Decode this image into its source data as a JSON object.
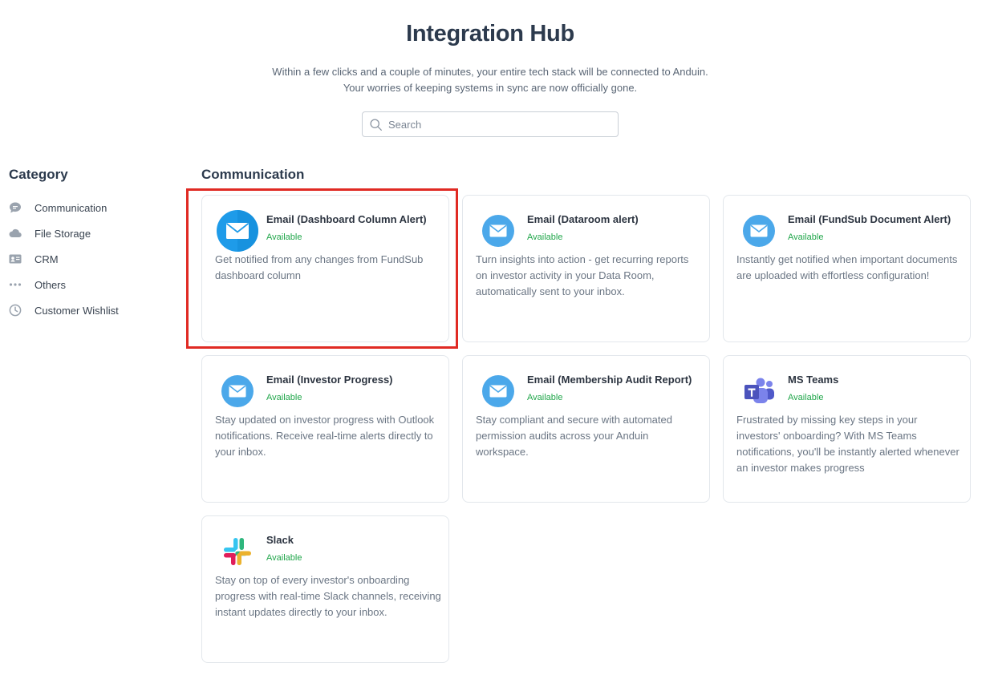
{
  "header": {
    "title": "Integration Hub",
    "subtitle_line1": "Within a few clicks and a couple of minutes, your entire tech stack will be connected to Anduin.",
    "subtitle_line2": "Your worries of keeping systems in sync are now officially gone."
  },
  "search": {
    "placeholder": "Search",
    "value": ""
  },
  "sidebar": {
    "title": "Category",
    "items": [
      {
        "label": "Communication",
        "icon": "chat-bubble-icon"
      },
      {
        "label": "File Storage",
        "icon": "cloud-icon"
      },
      {
        "label": "CRM",
        "icon": "contact-card-icon"
      },
      {
        "label": "Others",
        "icon": "ellipsis-icon"
      },
      {
        "label": "Customer Wishlist",
        "icon": "clock-icon"
      }
    ]
  },
  "main": {
    "section_title": "Communication",
    "cards": [
      {
        "title": "Email (Dashboard Column Alert)",
        "status": "Available",
        "description": "Get notified from any changes from FundSub dashboard column",
        "icon": "email-icon"
      },
      {
        "title": "Email (Dataroom alert)",
        "status": "Available",
        "description": "Turn insights into action - get recurring reports on investor activity in your Data Room, automatically sent to your inbox.",
        "icon": "email-icon"
      },
      {
        "title": "Email (FundSub Document Alert)",
        "status": "Available",
        "description": "Instantly get notified when important documents are uploaded with effortless configuration!",
        "icon": "email-icon"
      },
      {
        "title": "Email (Investor Progress)",
        "status": "Available",
        "description": "Stay updated on investor progress with Outlook notifications. Receive real-time alerts directly to your inbox.",
        "icon": "email-icon"
      },
      {
        "title": "Email (Membership Audit Report)",
        "status": "Available",
        "description": "Stay compliant and secure with automated permission audits across your Anduin workspace.",
        "icon": "email-icon"
      },
      {
        "title": "MS Teams",
        "status": "Available",
        "description": "Frustrated by missing key steps in your investors' onboarding? With MS Teams notifications, you'll be instantly alerted whenever an investor makes progress",
        "icon": "ms-teams-icon"
      },
      {
        "title": "Slack",
        "status": "Available",
        "description": "Stay on top of every investor's onboarding progress with real-time Slack channels, receiving instant updates directly to your inbox.",
        "icon": "slack-icon"
      }
    ]
  },
  "colors": {
    "status_available": "#20a64a",
    "email_icon_blue": "#4ba8ea",
    "highlight_red": "#e02a23"
  }
}
